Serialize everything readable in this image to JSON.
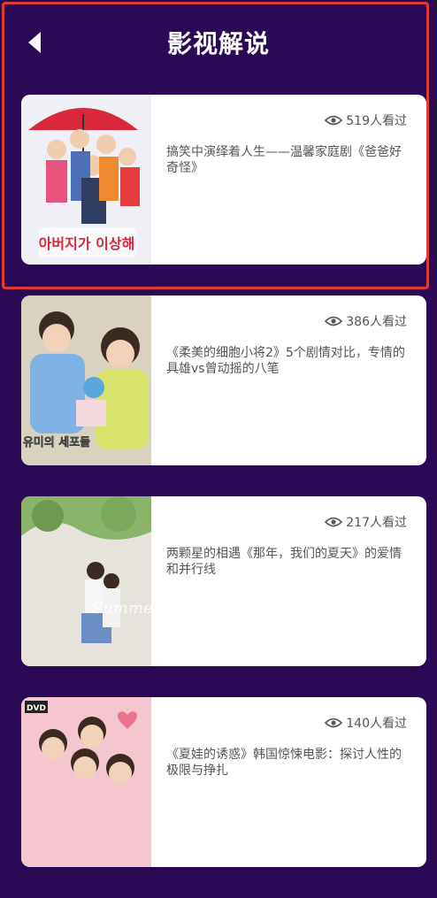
{
  "header": {
    "title": "影视解说"
  },
  "items": [
    {
      "views": "519人看过",
      "text": "搞笑中演绎着人生——温馨家庭剧《爸爸好奇怪》",
      "poster_text": "아버지가 이상해"
    },
    {
      "views": "386人看过",
      "text": "《柔美的细胞小将2》5个剧情对比，专情的具雄vs曾动摇的八笔",
      "poster_text": "유미의 세포들"
    },
    {
      "views": "217人看过",
      "text": "两颗星的相遇《那年，我们的夏天》的爱情和并行线",
      "poster_text": "Summer"
    },
    {
      "views": "140人看过",
      "text": "《夏娃的诱惑》韩国惊悚电影：探讨人性的极限与挣扎",
      "poster_text": "DVD"
    }
  ],
  "colors": {
    "background": "#2a0a55",
    "card": "#ffffff",
    "highlight": "#e23a3a"
  }
}
